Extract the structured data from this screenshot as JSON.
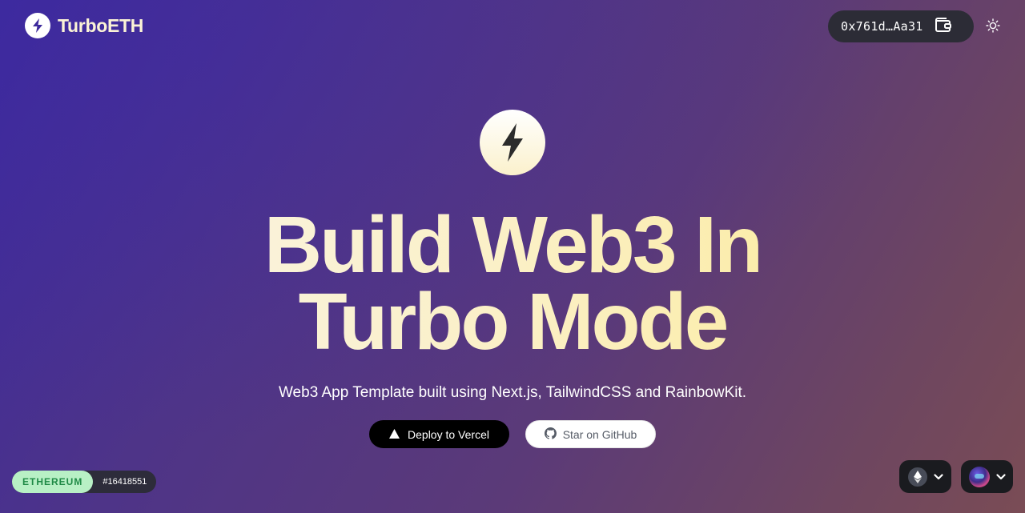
{
  "header": {
    "brand_name": "TurboETH",
    "wallet_address": "0x761d…Aa31"
  },
  "hero": {
    "title_line1": "Build Web3 In",
    "title_line2": "Turbo Mode",
    "subtitle": "Web3 App Template built using Next.js, TailwindCSS and RainbowKit.",
    "deploy_label": "Deploy to Vercel",
    "github_label": "Star on GitHub"
  },
  "footer": {
    "network_name": "ETHEREUM",
    "block_number": "#16418551"
  },
  "icons": {
    "brand": "lightning-bolt-icon",
    "wallet": "wallet-icon",
    "theme": "sun-icon",
    "deploy": "triangle-icon",
    "github": "github-icon",
    "chain": "ethereum-icon",
    "dropdown": "chevron-down-icon"
  },
  "colors": {
    "accent_text": "#fbf0bf",
    "network_badge_bg": "#b8f0c5",
    "network_badge_text": "#1f8a46"
  }
}
